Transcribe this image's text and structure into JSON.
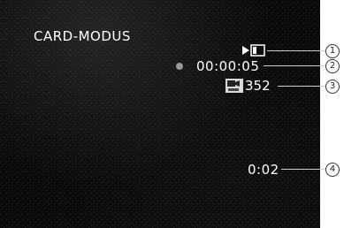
{
  "osd": {
    "mode_label": "CARD-MODUS",
    "timecode": "00:00:05",
    "counter": "352",
    "remaining_time": "0:02"
  },
  "icons": {
    "playback": "play-triangle-icon",
    "card": "memory-card-icon",
    "record_indicator": "record-dot-icon",
    "movie_card": "movie-card-icon"
  },
  "callouts": [
    "1",
    "2",
    "3",
    "4"
  ],
  "colors": {
    "screen_bg": "#0b0b0b",
    "text": "#ffffff",
    "callout_border": "#333333"
  }
}
